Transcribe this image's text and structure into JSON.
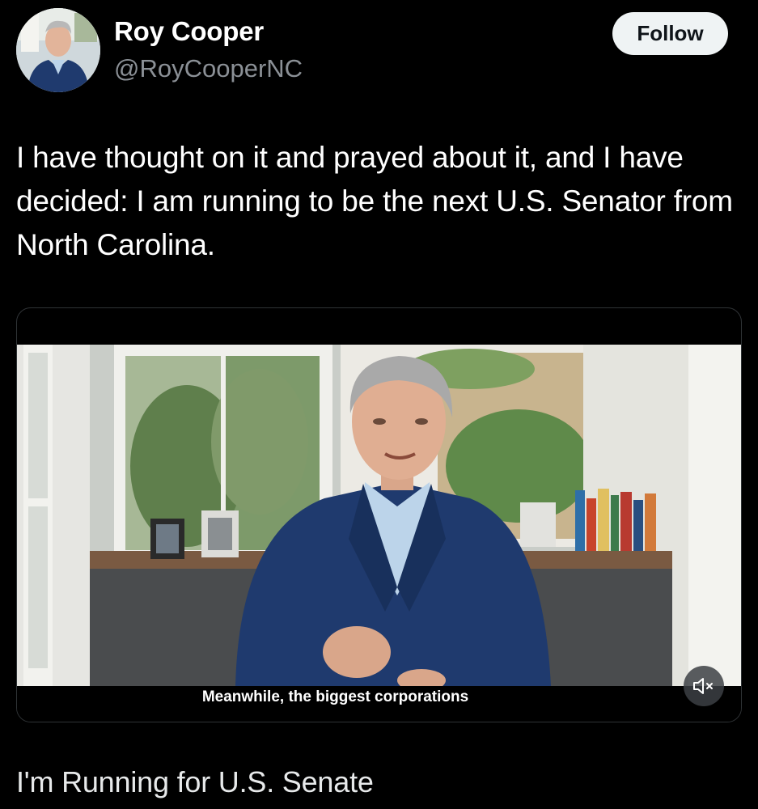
{
  "author": {
    "name": "Roy Cooper",
    "handle": "@RoyCooperNC"
  },
  "follow_label": "Follow",
  "post": {
    "text": "I have thought on it and prayed about it, and I have decided: I am running to be the next U.S. Senator from North Carolina."
  },
  "video": {
    "caption": "Meanwhile, the biggest corporations",
    "mute_icon": "muted-speaker-icon"
  },
  "card": {
    "title": "I'm Running for U.S. Senate"
  },
  "colors": {
    "background": "#000000",
    "name_text": "#ffffff",
    "handle_text": "#8b9096",
    "follow_bg": "#eff3f4",
    "follow_text": "#0f1419",
    "card_border": "#2f3336"
  }
}
